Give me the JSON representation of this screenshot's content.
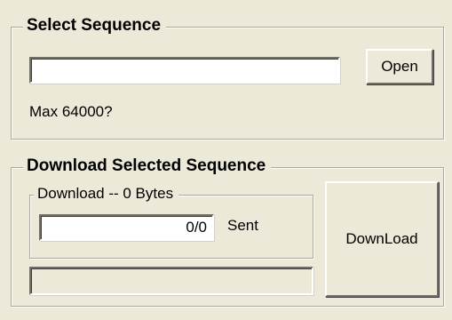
{
  "select_group": {
    "title": "Select Sequence",
    "path_value": "",
    "open_button": "Open",
    "max_label": "Max 64000?"
  },
  "download_group": {
    "title": "Download Selected Sequence",
    "inner_title": "Download -- 0 Bytes",
    "counter_value": "0/0",
    "sent_label": "Sent",
    "progress_fraction": 0,
    "download_button": "DownLoad"
  }
}
